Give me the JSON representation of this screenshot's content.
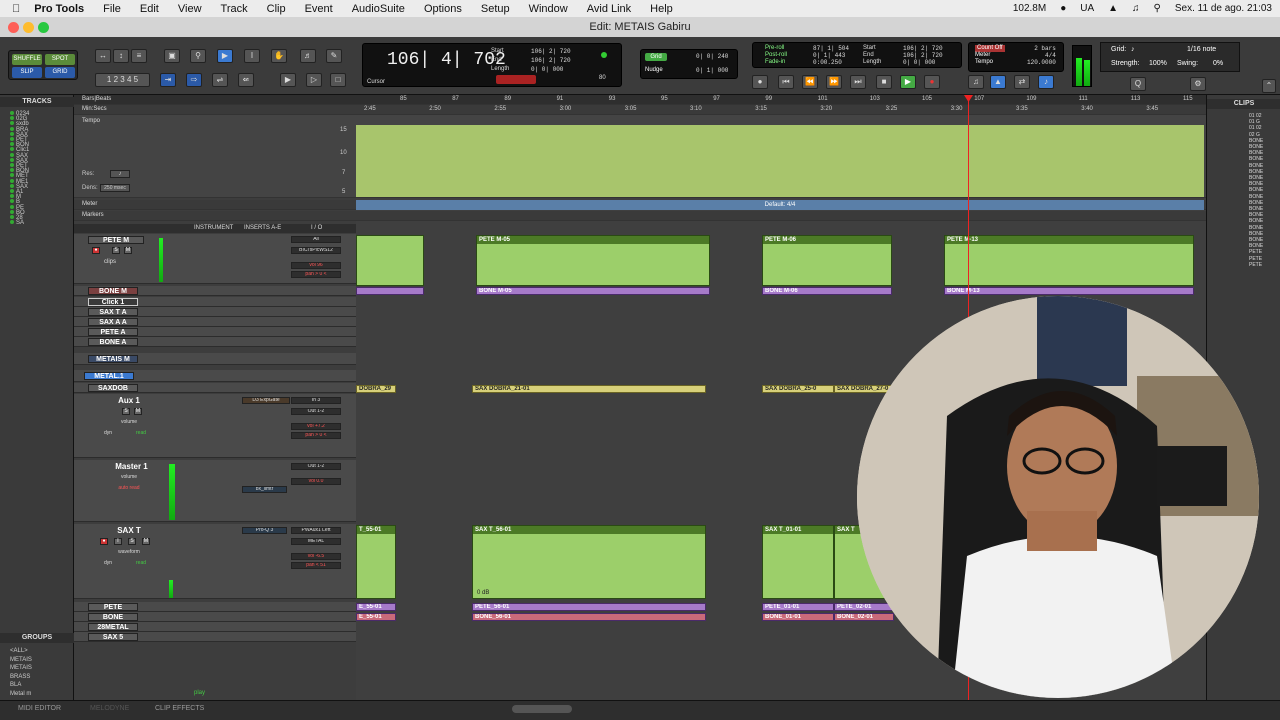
{
  "menubar": {
    "app": "Pro Tools",
    "items": [
      "File",
      "Edit",
      "View",
      "Track",
      "Clip",
      "Event",
      "AudioSuite",
      "Options",
      "Setup",
      "Window",
      "Avid Link",
      "Help"
    ],
    "memory": "102.8M",
    "input": "UA",
    "datetime": "Sex. 11 de ago.  21:03"
  },
  "window": {
    "title": "Edit: METAIS Gabiru"
  },
  "toolbar": {
    "modes": [
      "SHUFFLE",
      "SPOT",
      "SLIP",
      "GRID"
    ],
    "main_counter": "106| 4| 702",
    "cursor_label": "Cursor",
    "sel_labels": [
      "Start",
      "End",
      "Length"
    ],
    "sel_values": [
      "106| 2| 720",
      "106| 2| 720",
      "0| 0| 000"
    ],
    "tempo_mini": "80",
    "grid_label": "Grid",
    "grid_value": "0| 0| 240",
    "nudge_label": "Nudge",
    "nudge_value": "0| 1| 000",
    "preroll_labels": [
      "Pre-roll",
      "Post-roll",
      "Fade-in"
    ],
    "preroll_values": [
      "87| 1| 504",
      "0| 1| 443",
      "0:00.250"
    ],
    "sel2_labels": [
      "Start",
      "End",
      "Length"
    ],
    "sel2_values": [
      "106| 2| 720",
      "106| 2| 720",
      "0| 0| 000"
    ],
    "countoff_labels": [
      "Count Off",
      "Meter",
      "Tempo"
    ],
    "countoff_values": [
      "2 bars",
      "4/4",
      "120.0000"
    ],
    "grid2_label": "Grid:",
    "grid2_value": "1/16 note",
    "strength_label": "Strength:",
    "strength_value": "100%",
    "swing_label": "Swing:",
    "swing_value": "0%"
  },
  "left_panel": {
    "tracks_header": "TRACKS",
    "tracks": [
      "0234",
      "02G",
      "sxdb",
      "BRA",
      "SAX",
      "PET",
      "BON",
      "Clic1",
      "SAX",
      "SAX",
      "PET",
      "BON",
      "MET",
      "ME1",
      "SAX",
      "A1",
      "M",
      "B",
      "PE",
      "BO",
      "28",
      "SA"
    ],
    "groups_header": "GROUPS",
    "groups": [
      "<ALL>",
      "METAIS",
      "METAIS",
      "BRASS",
      "BLA",
      "Metal m"
    ]
  },
  "rulers": {
    "bars_label": "Bars|Beats",
    "mins_label": "Min:Secs",
    "tempo_label": "Tempo",
    "meter_label": "Meter",
    "markers_label": "Markers",
    "meter_default": "Default: 4/4",
    "bar_ticks": [
      "85",
      "87",
      "89",
      "91",
      "93",
      "95",
      "97",
      "99",
      "101",
      "103",
      "105",
      "107",
      "109",
      "111",
      "113",
      "115"
    ],
    "time_ticks": [
      "2:45",
      "2:50",
      "2:55",
      "3:00",
      "3:05",
      "3:10",
      "3:15",
      "3:20",
      "3:25",
      "3:30",
      "3:35",
      "3:40",
      "3:45"
    ],
    "tempo_scale": [
      "15",
      "10",
      "7",
      "5"
    ],
    "res_label": "Res:",
    "dens_label": "Dens:",
    "dens_value": "250 msec"
  },
  "column_headers": {
    "instrument": "INSTRUMENT",
    "inserts": "INSERTS A-E",
    "io": "I / O"
  },
  "tracks": {
    "pete_m": {
      "name": "PETE M",
      "io_in": "All",
      "io_out": "BICI'sPlcWS12",
      "vol": "vol 96",
      "pan": "pan > 0 <",
      "clips_label": "clips"
    },
    "bone_m": {
      "name": "BONE M"
    },
    "click": {
      "name": "Click 1"
    },
    "sax_ta": {
      "name": "SAX T A"
    },
    "sax_aa": {
      "name": "SAX A A"
    },
    "pete_a": {
      "name": "PETE A"
    },
    "bone_a": {
      "name": "BONE A"
    },
    "metais_m": {
      "name": "METAIS M"
    },
    "metal1": {
      "name": "METAL.1"
    },
    "saxdob": {
      "name": "SAXDOB"
    },
    "aux1": {
      "name": "Aux 1",
      "volume_label": "volume",
      "insert": "D3 ExpGate",
      "io_in": "In 3",
      "io_out": "Out 1-2",
      "vol": "vol +7.2",
      "pan": "pan > 0 <",
      "dyn": "dyn",
      "read": "read"
    },
    "master1": {
      "name": "Master 1",
      "volume_label": "volume",
      "auto": "auto read",
      "insert": "bx_limtr",
      "io_out": "Out 1-2",
      "vol": "vol 0.0"
    },
    "saxt": {
      "name": "SAX T",
      "view": "waveform",
      "insert": "Pro-Q 3",
      "io_in": "PWAux1 Left",
      "io_out": "METAL",
      "vol": "vol -6.5",
      "pan": "pan < 51",
      "dyn": "dyn",
      "read": "read"
    },
    "pete": {
      "name": "PETE"
    },
    "bone": {
      "name": "BONE"
    },
    "metal28": {
      "name": "28METAL"
    },
    "sax5": {
      "name": "SAX 5"
    }
  },
  "clips": {
    "pete_m": [
      "PETE M-05",
      "PETE M-06",
      "PETE M-13"
    ],
    "bone_m": [
      "BONE M-05",
      "BONE M-06",
      "BONE M-13"
    ],
    "saxdob": [
      "DOBRA_29",
      "SAX DOBRA_21-01",
      "SAX DOBRA_25-0",
      "SAX DOBRA_27-0"
    ],
    "saxt": [
      "T_55-01",
      "SAX T_56-01",
      "SAX T_01-01",
      "SAX T"
    ],
    "pete": [
      "E_55-01",
      "PETE_56-01",
      "PETE_01-01",
      "PETE_02-01"
    ],
    "bone": [
      "E_55-01",
      "BONE_56-01",
      "BONE_01-01",
      "BONE_02-01"
    ],
    "gain": "0 dB"
  },
  "right_panel": {
    "header": "CLIPS",
    "items": [
      "01 02",
      "01 G",
      "01 02",
      "02 G",
      "BONE",
      "BONE",
      "BONE",
      "BONE",
      "BONE",
      "BONE",
      "BONE",
      "BONE",
      "BONE",
      "BONE",
      "BONE",
      "BONE",
      "BONE",
      "BONE",
      "BONE",
      "BONE",
      "BONE",
      "BONE",
      "PETE",
      "PETE",
      "PETE"
    ]
  },
  "bottom_tabs": [
    "MIDI EDITOR",
    "MELODYNE",
    "CLIP EFFECTS"
  ],
  "play_label": "play",
  "colors": {
    "clip_green": "#9ccf6a",
    "clip_purple": "#a67ac9",
    "clip_yellow": "#d7d07a",
    "selected_blue": "#3b7ad1"
  }
}
